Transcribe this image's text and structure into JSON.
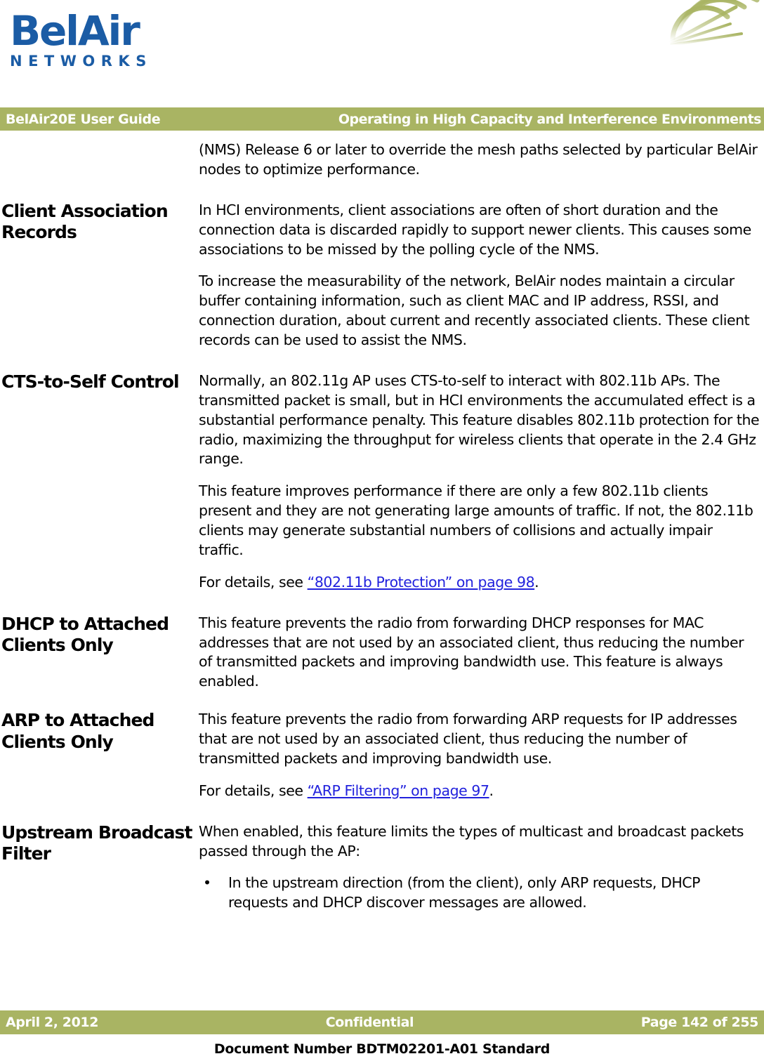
{
  "brand": {
    "logo_primary": "BelAir",
    "logo_secondary": "NETWORKS",
    "logo_color": "#1b5ca5",
    "accent_color": "#a9b463",
    "link_color": "#2222dd"
  },
  "header": {
    "left": "BelAir20E User Guide",
    "right": "Operating in High Capacity and Interference Environments"
  },
  "intro": {
    "text": "(NMS) Release 6 or later to override the mesh paths selected by particular BelAir nodes to optimize performance."
  },
  "sections": [
    {
      "heading": "Client Association Records",
      "paragraphs": [
        "In HCI environments, client associations are often of short duration and the connection data is discarded rapidly to support newer clients. This causes some associations to be missed by the polling cycle of the NMS.",
        "To increase the measurability of the network, BelAir nodes maintain a circular buffer containing information, such as client MAC and IP address, RSSI, and connection duration, about current and recently associated clients. These client records can be used to assist the NMS."
      ]
    },
    {
      "heading": "CTS-to-Self Control",
      "paragraphs": [
        "Normally, an 802.11g AP uses CTS-to-self to interact with 802.11b APs. The transmitted packet is small, but in HCI environments the accumulated effect is a substantial performance penalty. This feature disables 802.11b protection for the radio, maximizing the throughput for wireless clients that operate in the 2.4 GHz range.",
        "This feature improves performance if there are only a few 802.11b clients present and they are not generating large amounts of traffic. If not, the 802.11b clients may generate substantial numbers of collisions and actually impair traffic."
      ],
      "xref_prefix": "For details, see ",
      "xref_link": "“802.11b Protection” on page 98",
      "xref_suffix": "."
    },
    {
      "heading": "DHCP to Attached Clients Only",
      "paragraphs": [
        "This feature prevents the radio from forwarding DHCP responses for MAC addresses that are not used by an associated client, thus reducing the number of transmitted packets and improving bandwidth use. This feature is always enabled."
      ]
    },
    {
      "heading": "ARP to Attached Clients Only",
      "paragraphs": [
        "This feature prevents the radio from forwarding ARP requests for IP addresses that are not used by an associated client, thus reducing the number of transmitted packets and improving bandwidth use."
      ],
      "xref_prefix": "For details, see ",
      "xref_link": "“ARP Filtering” on page 97",
      "xref_suffix": "."
    },
    {
      "heading": "Upstream Broadcast Filter",
      "paragraphs": [
        "When enabled, this feature limits the types of multicast and broadcast packets passed through the AP:"
      ],
      "bullets": [
        "In the upstream direction (from the client), only ARP requests, DHCP requests and DHCP discover messages are allowed."
      ],
      "bullet_glyph": "•"
    }
  ],
  "footer": {
    "date": "April 2, 2012",
    "classification": "Confidential",
    "page": "Page 142 of 255",
    "document_number": "Document Number BDTM02201-A01 Standard"
  }
}
